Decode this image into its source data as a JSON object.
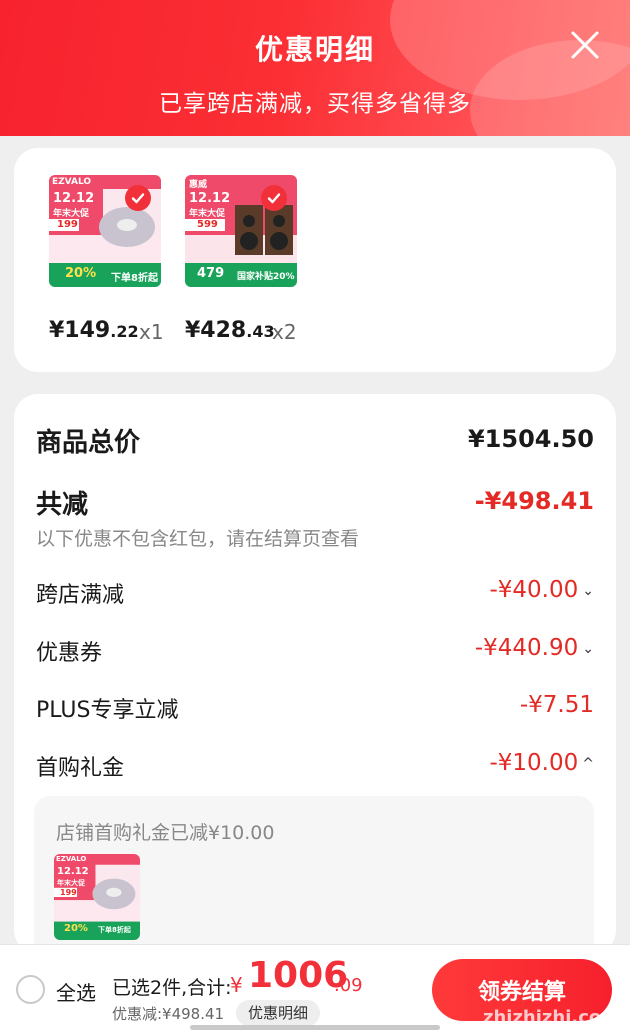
{
  "header": {
    "title": "优惠明细",
    "subtitle": "已享跨店满减，买得多省得多"
  },
  "products": [
    {
      "price_int": "¥149",
      "price_dec": ".22",
      "qty": "x1",
      "thumb_brand": "EZVALO",
      "thumb_promo": "12.12",
      "thumb_sub": "年末大促",
      "thumb_price": "199",
      "thumb_pct": "20%",
      "thumb_cta": "下单8折起"
    },
    {
      "price_int": "¥428",
      "price_dec": ".43",
      "qty": "x2",
      "thumb_brand": "惠威",
      "thumb_promo": "12.12",
      "thumb_sub": "年末大促",
      "thumb_price": "599",
      "thumb_pct": "479",
      "thumb_cta": "国家补贴20%"
    }
  ],
  "summary": {
    "total_label": "商品总价",
    "total_value": "¥1504.50",
    "reduced_label": "共减",
    "reduced_value": "-¥498.41",
    "hint": "以下优惠不包含红包，请在结算页查看",
    "rows": [
      {
        "label": "跨店满减",
        "value": "-¥40.00",
        "chevron": "chevron-down"
      },
      {
        "label": "优惠券",
        "value": "-¥440.90",
        "chevron": "chevron-down"
      },
      {
        "label": "PLUS专享立减",
        "value": "-¥7.51",
        "chevron": ""
      },
      {
        "label": "首购礼金",
        "value": "-¥10.00",
        "chevron": "chevron-up"
      }
    ],
    "subcard": {
      "title": "店铺首购礼金已减¥10.00"
    }
  },
  "footer": {
    "select_all": "全选",
    "selected_info": "已选2件,合计:",
    "total_symbol": "¥",
    "total_int": "1006",
    "total_dec": ".09",
    "saved": "优惠减:¥498.41",
    "detail_button": "优惠明细",
    "checkout_button": "领券结算",
    "watermark": "zhizhizhi.com"
  },
  "colors": {
    "accent": "#f2303a",
    "discount": "#e42a25"
  }
}
